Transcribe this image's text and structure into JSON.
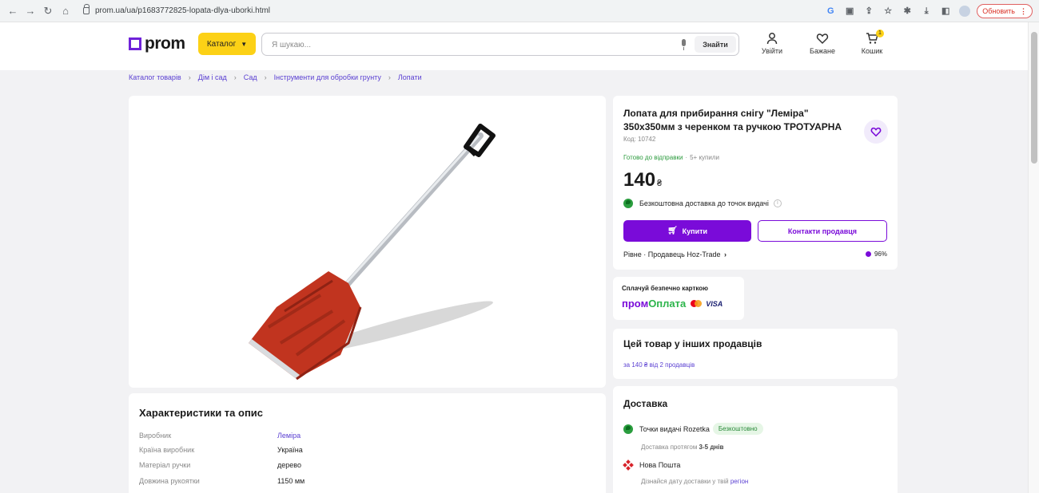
{
  "browser": {
    "url": "prom.ua/ua/p1683772825-lopata-dlya-uborki.html",
    "update_label": "Обновить"
  },
  "header": {
    "logo_text": "prom",
    "catalog_label": "Каталог",
    "search_placeholder": "Я шукаю...",
    "search_button": "Знайти",
    "login_label": "Увійти",
    "wishlist_label": "Бажане",
    "cart_label": "Кошик",
    "cart_count": "1"
  },
  "breadcrumb": [
    "Каталог товарів",
    "Дім і сад",
    "Сад",
    "Інструменти для обробки грунту",
    "Лопати"
  ],
  "product": {
    "title_line1": "Лопата для прибирання снігу \"Леміра\"",
    "title_line2": "350x350мм з черенком та ручкою ТРОТУАРНА",
    "code": "Код: 10742",
    "status": "Готово до відправки",
    "bought": "5+ купили",
    "price": "140",
    "currency": "₴",
    "free_delivery": "Безкоштовна доставка до точок видачі",
    "buy_label": "Купити",
    "contact_label": "Контакти продавця",
    "seller": "Рівне · Продавець Hoz-Trade",
    "rating": "96%"
  },
  "pay": {
    "title": "Сплачуй безпечно карткою",
    "logo_prom": "пром",
    "logo_oplata": "Оплата",
    "visa": "VISA"
  },
  "others": {
    "title": "Цей товар у інших продавців",
    "link": "за 140 ₴  від 2 продавців"
  },
  "delivery": {
    "title": "Доставка",
    "rozetka": "Точки видачі Rozetka",
    "free_badge": "Безкоштовно",
    "rozetka_sub_prefix": "Доставка протягом ",
    "rozetka_sub_days": "3-5 днів",
    "nova": "Нова Пошта",
    "nova_sub_prefix": "Дізнайся дату доставки у твій ",
    "nova_sub_link": "регіон"
  },
  "characteristics": {
    "title": "Характеристики та опис",
    "rows": [
      {
        "label": "Виробник",
        "value": "Леміра"
      },
      {
        "label": "Країна виробник",
        "value": "Україна"
      },
      {
        "label": "Матеріал ручки",
        "value": "дерево"
      },
      {
        "label": "Довжина рукоятки",
        "value": "1150 мм"
      }
    ]
  },
  "colors": {
    "accent": "#7a0bd9",
    "catalog": "#fcd116",
    "shovel": "#c1341f"
  }
}
